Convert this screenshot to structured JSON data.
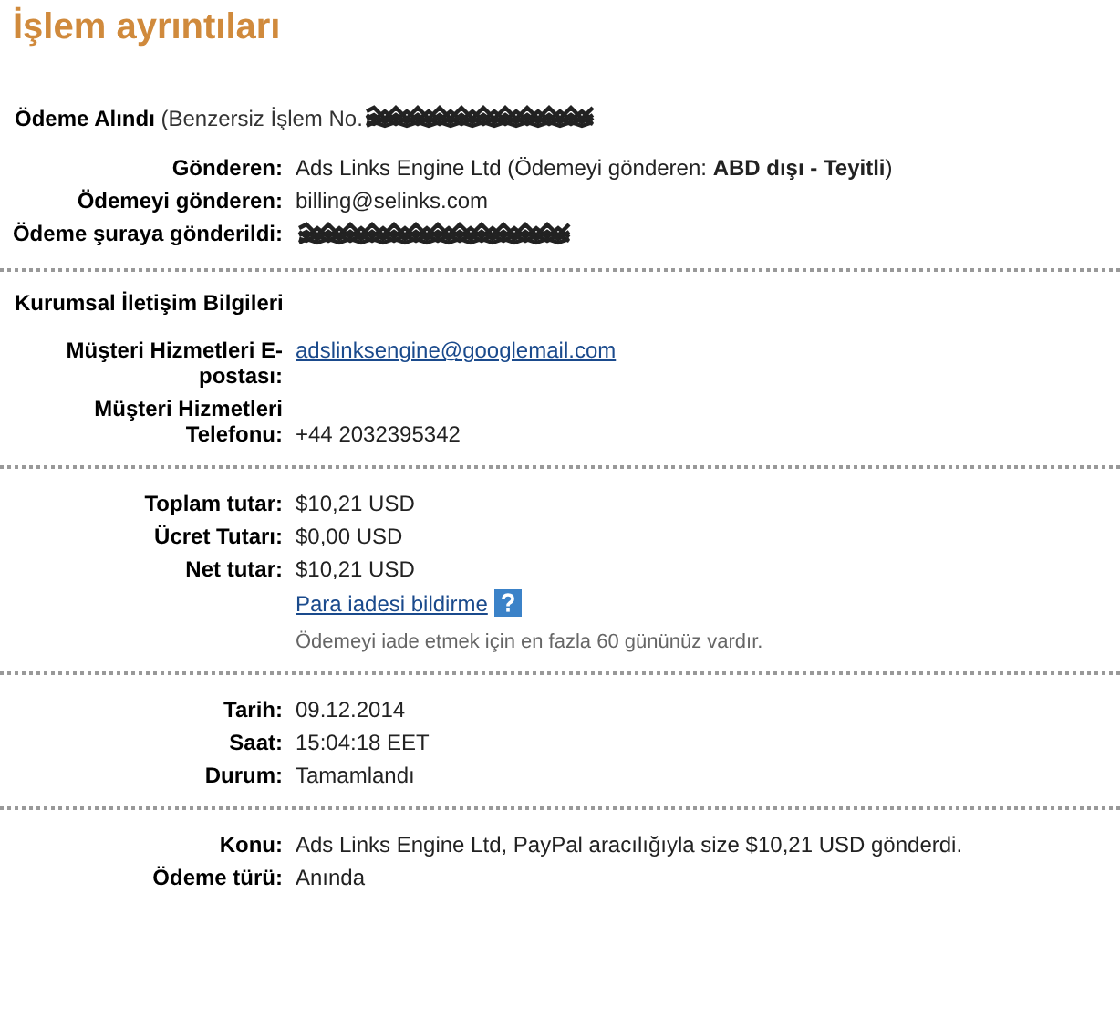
{
  "title": "İşlem ayrıntıları",
  "sections": [
    {
      "heading": "**Ödeme Alındı** (Benzersiz İşlem No.",
      "heading_redacted": true,
      "rows": [
        {
          "label": "Gönderen:",
          "value": "Ads Links Engine Ltd (Ödemeyi gönderen: **ABD dışı - Teyitli**)",
          "kind": "text"
        },
        {
          "label": "Ödemeyi gönderen:",
          "value": "billing@selinks.com",
          "kind": "text"
        },
        {
          "label": "Ödeme şuraya gönderildi:",
          "kind": "redacted"
        }
      ]
    },
    {
      "heading": "**Kurumsal İletişim Bilgileri**",
      "rows": [
        {
          "label": "Müşteri Hizmetleri E-postası:",
          "value": "adslinksengine@googlemail.com",
          "kind": "link"
        },
        {
          "label": "Müşteri Hizmetleri Telefonu:",
          "value": "+44 2032395342",
          "kind": "text"
        }
      ]
    },
    {
      "rows": [
        {
          "label": "Toplam tutar:",
          "value": "$10,21 USD",
          "kind": "text"
        },
        {
          "label": "Ücret Tutarı:",
          "value": "$0,00 USD",
          "kind": "text"
        },
        {
          "label": "Net tutar:",
          "value": "$10,21 USD",
          "kind": "text"
        },
        {
          "value": "Para iadesi bildirme",
          "kind": "help-link"
        },
        {
          "value": "Ödemeyi iade etmek için en fazla 60 gününüz vardır.",
          "kind": "note"
        }
      ]
    },
    {
      "rows": [
        {
          "label": "Tarih:",
          "value": "09.12.2014",
          "kind": "text"
        },
        {
          "label": "Saat:",
          "value": "15:04:18 EET",
          "kind": "text"
        },
        {
          "label": "Durum:",
          "value": "Tamamlandı",
          "kind": "text"
        }
      ]
    },
    {
      "rows": [
        {
          "label": "Konu:",
          "value": "Ads Links Engine Ltd, PayPal aracılığıyla size $10,21 USD gönderdi.",
          "kind": "text"
        },
        {
          "label": "Ödeme türü:",
          "value": "Anında",
          "kind": "text"
        }
      ]
    }
  ]
}
